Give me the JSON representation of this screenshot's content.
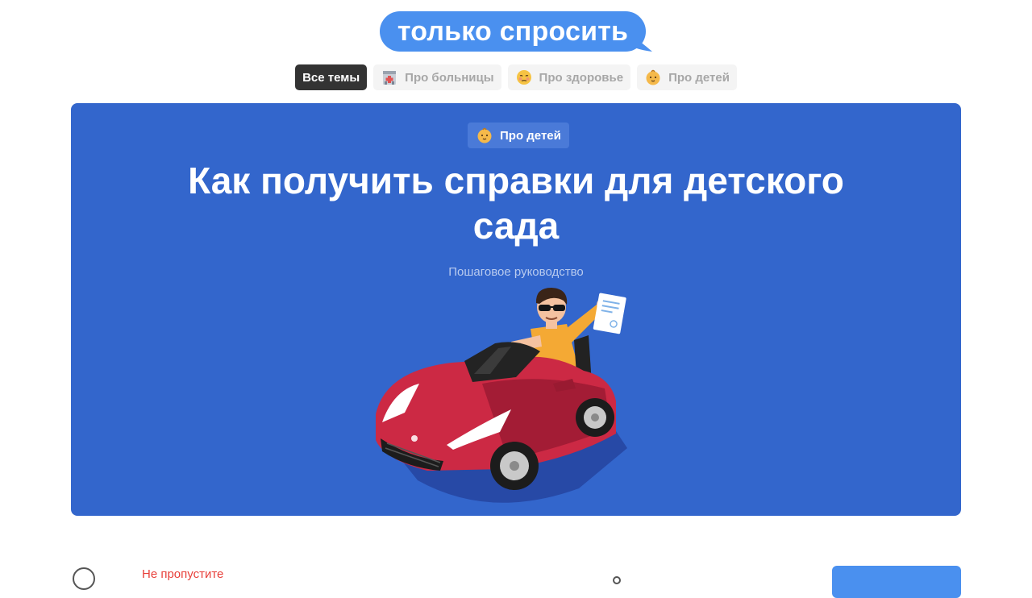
{
  "logo": {
    "text": "только спросить"
  },
  "tabs": [
    {
      "label": "Все темы",
      "icon": "",
      "active": true
    },
    {
      "label": "Про больницы",
      "icon": "hospital-icon",
      "active": false
    },
    {
      "label": "Про здоровье",
      "icon": "sick-face-icon",
      "active": false
    },
    {
      "label": "Про детей",
      "icon": "baby-icon",
      "active": false
    }
  ],
  "hero": {
    "tag": {
      "label": "Про детей",
      "icon": "baby-icon"
    },
    "title_line1": "Как получить справки для детского",
    "title_line2": "сада",
    "subtitle": "Пошаговое руководство",
    "illustration": "man-in-toy-car-with-document",
    "background_color": "#3366cc"
  },
  "bottom": {
    "label": "Не пропустите",
    "label_color": "#e8403a"
  },
  "colors": {
    "brand_blue": "#4a90ef",
    "active_tab": "#333333"
  }
}
